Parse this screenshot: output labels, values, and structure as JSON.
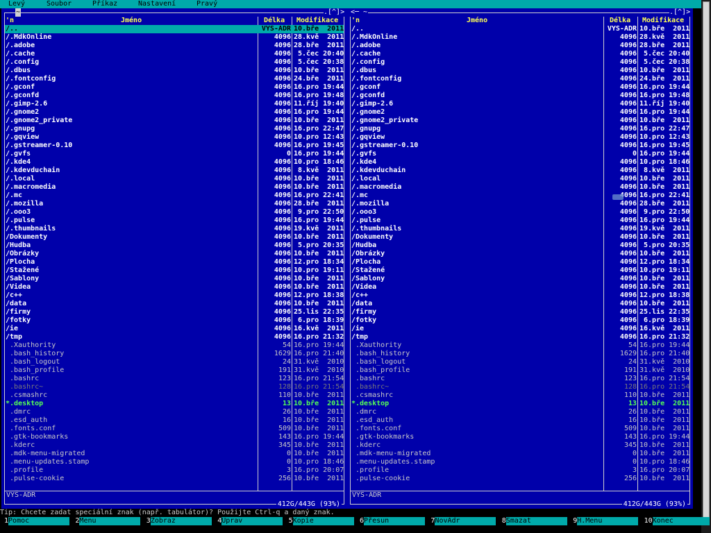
{
  "menubar": {
    "items": [
      "Levý",
      "Soubor",
      "Příkaz",
      "Nastavení",
      "Pravý"
    ]
  },
  "colors": {
    "panel_bg": "#0000aa",
    "menubar_bg": "#00aaaa",
    "selection_bg": "#00aaaa",
    "header_text": "#ffff55",
    "exec_text": "#55ff55"
  },
  "left_panel": {
    "path": "~",
    "corner": ".[^]>",
    "headers": {
      "sort": "'n",
      "name": "Jméno",
      "size": "Délka",
      "mtime": "Modifikace"
    },
    "status": "VYŠ-ADR",
    "disk": "412G/443G (93%)"
  },
  "right_panel": {
    "path": "<─ ~",
    "corner": ".[^]>",
    "headers": {
      "sort": "'n",
      "name": "Jméno",
      "size": "Délka",
      "mtime": "Modifikace"
    },
    "status": "VYŠ-ADR",
    "disk": "412G/443G (93%)"
  },
  "files": [
    {
      "name": "/..",
      "size": "VYŠ-ADR",
      "mtime": "10.bře  2011",
      "kind": "dir"
    },
    {
      "name": "/.MdkOnline",
      "size": "4096",
      "mtime": "28.kvě  2011",
      "kind": "dir"
    },
    {
      "name": "/.adobe",
      "size": "4096",
      "mtime": "28.bře  2011",
      "kind": "dir"
    },
    {
      "name": "/.cache",
      "size": "4096",
      "mtime": " 5.čec 20:40",
      "kind": "dir"
    },
    {
      "name": "/.config",
      "size": "4096",
      "mtime": " 5.čec 20:38",
      "kind": "dir"
    },
    {
      "name": "/.dbus",
      "size": "4096",
      "mtime": "10.bře  2011",
      "kind": "dir"
    },
    {
      "name": "/.fontconfig",
      "size": "4096",
      "mtime": "24.bře  2011",
      "kind": "dir"
    },
    {
      "name": "/.gconf",
      "size": "4096",
      "mtime": "16.pro 19:44",
      "kind": "dir"
    },
    {
      "name": "/.gconfd",
      "size": "4096",
      "mtime": "16.pro 19:48",
      "kind": "dir"
    },
    {
      "name": "/.gimp-2.6",
      "size": "4096",
      "mtime": "11.říj 19:40",
      "kind": "dir"
    },
    {
      "name": "/.gnome2",
      "size": "4096",
      "mtime": "16.pro 19:44",
      "kind": "dir"
    },
    {
      "name": "/.gnome2_private",
      "size": "4096",
      "mtime": "10.bře  2011",
      "kind": "dir"
    },
    {
      "name": "/.gnupg",
      "size": "4096",
      "mtime": "16.pro 22:47",
      "kind": "dir"
    },
    {
      "name": "/.gqview",
      "size": "4096",
      "mtime": "10.pro 12:43",
      "kind": "dir"
    },
    {
      "name": "/.gstreamer-0.10",
      "size": "4096",
      "mtime": "16.pro 19:45",
      "kind": "dir"
    },
    {
      "name": "/.gvfs",
      "size": "0",
      "mtime": "16.pro 19:44",
      "kind": "dir"
    },
    {
      "name": "/.kde4",
      "size": "4096",
      "mtime": "10.pro 18:46",
      "kind": "dir"
    },
    {
      "name": "/.kdevduchain",
      "size": "4096",
      "mtime": " 8.kvě  2011",
      "kind": "dir"
    },
    {
      "name": "/.local",
      "size": "4096",
      "mtime": "10.bře  2011",
      "kind": "dir"
    },
    {
      "name": "/.macromedia",
      "size": "4096",
      "mtime": "10.bře  2011",
      "kind": "dir"
    },
    {
      "name": "/.mc",
      "size": "4096",
      "mtime": "16.pro 22:41",
      "kind": "dir"
    },
    {
      "name": "/.mozilla",
      "size": "4096",
      "mtime": "28.bře  2011",
      "kind": "dir"
    },
    {
      "name": "/.ooo3",
      "size": "4096",
      "mtime": " 9.pro 22:50",
      "kind": "dir"
    },
    {
      "name": "/.pulse",
      "size": "4096",
      "mtime": "16.pro 19:44",
      "kind": "dir"
    },
    {
      "name": "/.thumbnails",
      "size": "4096",
      "mtime": "19.kvě  2011",
      "kind": "dir"
    },
    {
      "name": "/Dokumenty",
      "size": "4096",
      "mtime": "10.bře  2011",
      "kind": "dir"
    },
    {
      "name": "/Hudba",
      "size": "4096",
      "mtime": " 5.pro 20:35",
      "kind": "dir"
    },
    {
      "name": "/Obrázky",
      "size": "4096",
      "mtime": "10.bře  2011",
      "kind": "dir"
    },
    {
      "name": "/Plocha",
      "size": "4096",
      "mtime": "12.pro 18:34",
      "kind": "dir"
    },
    {
      "name": "/Stažené",
      "size": "4096",
      "mtime": "10.pro 19:11",
      "kind": "dir"
    },
    {
      "name": "/Šablony",
      "size": "4096",
      "mtime": "10.bře  2011",
      "kind": "dir"
    },
    {
      "name": "/Videa",
      "size": "4096",
      "mtime": "10.bře  2011",
      "kind": "dir"
    },
    {
      "name": "/c++",
      "size": "4096",
      "mtime": "12.pro 18:38",
      "kind": "dir"
    },
    {
      "name": "/data",
      "size": "4096",
      "mtime": "10.bře  2011",
      "kind": "dir"
    },
    {
      "name": "/firmy",
      "size": "4096",
      "mtime": "25.lis 22:35",
      "kind": "dir"
    },
    {
      "name": "/fotky",
      "size": "4096",
      "mtime": " 6.pro 18:39",
      "kind": "dir"
    },
    {
      "name": "/ie",
      "size": "4096",
      "mtime": "16.kvě  2011",
      "kind": "dir"
    },
    {
      "name": "/tmp",
      "size": "4096",
      "mtime": "16.pro 21:32",
      "kind": "dir"
    },
    {
      "name": " .Xauthority",
      "size": "54",
      "mtime": "16.pro 19:44",
      "kind": "file"
    },
    {
      "name": " .bash_history",
      "size": "1629",
      "mtime": "16.pro 21:40",
      "kind": "file"
    },
    {
      "name": " .bash_logout",
      "size": "24",
      "mtime": "31.kvě  2010",
      "kind": "file"
    },
    {
      "name": " .bash_profile",
      "size": "191",
      "mtime": "31.kvě  2010",
      "kind": "file"
    },
    {
      "name": " .bashrc",
      "size": "123",
      "mtime": "16.pro 21:54",
      "kind": "file"
    },
    {
      "name": " .bashrc~",
      "size": "128",
      "mtime": "16.pro 21:54",
      "kind": "hidden"
    },
    {
      "name": " .csmashrc",
      "size": "110",
      "mtime": "10.bře  2011",
      "kind": "file"
    },
    {
      "name": "*.desktop",
      "size": "13",
      "mtime": "10.bře  2011",
      "kind": "exec"
    },
    {
      "name": " .dmrc",
      "size": "26",
      "mtime": "10.bře  2011",
      "kind": "file"
    },
    {
      "name": " .esd_auth",
      "size": "16",
      "mtime": "10.bře  2011",
      "kind": "file"
    },
    {
      "name": " .fonts.conf",
      "size": "509",
      "mtime": "10.bře  2011",
      "kind": "file"
    },
    {
      "name": " .gtk-bookmarks",
      "size": "143",
      "mtime": "16.pro 19:44",
      "kind": "file"
    },
    {
      "name": " .kderc",
      "size": "345",
      "mtime": "10.bře  2011",
      "kind": "file"
    },
    {
      "name": " .mdk-menu-migrated",
      "size": "0",
      "mtime": "10.bře  2011",
      "kind": "file"
    },
    {
      "name": " .menu-updates.stamp",
      "size": "0",
      "mtime": "10.pro 18:46",
      "kind": "file"
    },
    {
      "name": " .profile",
      "size": "3",
      "mtime": "16.pro 20:07",
      "kind": "file"
    },
    {
      "name": " .pulse-cookie",
      "size": "256",
      "mtime": "10.bře  2011",
      "kind": "file"
    }
  ],
  "hint": "Tip: Chcete zadat speciální znak (např. tabulátor)? Použijte Ctrl-q a daný znak.",
  "fkeys": [
    {
      "num": "1",
      "label": "Pomoc"
    },
    {
      "num": "2",
      "label": "Menu"
    },
    {
      "num": "3",
      "label": "Zobraz"
    },
    {
      "num": "4",
      "label": "Uprav"
    },
    {
      "num": "5",
      "label": "Kopie"
    },
    {
      "num": "6",
      "label": "Přesun"
    },
    {
      "num": "7",
      "label": "NovAdr"
    },
    {
      "num": "8",
      "label": "Smazat"
    },
    {
      "num": "9",
      "label": "H.Menu"
    },
    {
      "num": "10",
      "label": "Konec"
    }
  ]
}
